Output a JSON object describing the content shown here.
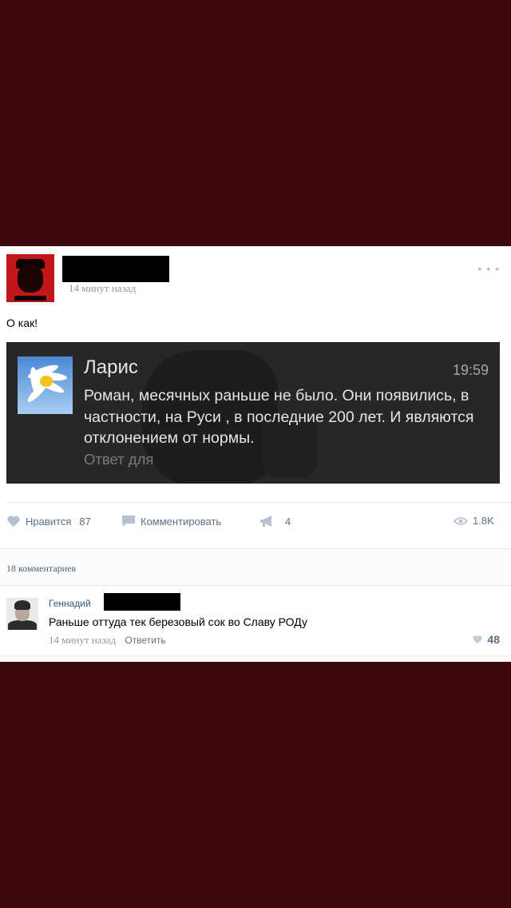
{
  "post": {
    "time": "14 минут назад",
    "text": "О как!",
    "menu_icon": "more-dots-icon",
    "embedded_screenshot": {
      "sender": "Ларис",
      "time": "19:59",
      "message": "Роман, месячных раньше не было. Они появились, в частности, на Руси , в последние 200 лет. И являются отклонением от нормы.",
      "reply_hint": "Ответ для"
    },
    "actions": {
      "like_label": "Нравится",
      "like_count": "87",
      "comment_label": "Комментировать",
      "share_count": "4",
      "views_count": "1.8K"
    }
  },
  "comments": {
    "count_label": "18 комментариев",
    "items": [
      {
        "author": "Геннадий",
        "text": "Раньше оттуда тек березовый сок во Славу РОДу",
        "time": "14 минут назад",
        "reply_label": "Ответить",
        "likes": "48"
      }
    ]
  },
  "colors": {
    "background": "#3c0a0d",
    "link": "#2a5885",
    "action": "#5b7089",
    "icon": "#b5c1cf"
  }
}
